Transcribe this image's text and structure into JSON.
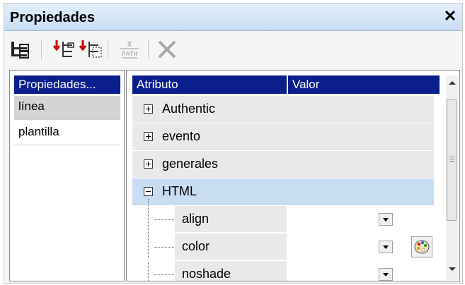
{
  "panel": {
    "title": "Propiedades",
    "close_glyph": "✕"
  },
  "toolbar": {
    "buttons": [
      {
        "name": "tree-layout-icon"
      },
      {
        "name": "add-child-icon"
      },
      {
        "name": "add-sibling-icon"
      },
      {
        "name": "xpath-icon",
        "line1": "X",
        "line2": "PATH"
      },
      {
        "name": "delete-icon"
      }
    ]
  },
  "left": {
    "header": "Propiedades...",
    "items": [
      {
        "label": "línea",
        "selected": true
      },
      {
        "label": "plantilla",
        "selected": false
      }
    ]
  },
  "right": {
    "columns": {
      "attribute": "Atributo",
      "value": "Valor"
    },
    "groups": [
      {
        "label": "Authentic",
        "expanded": false
      },
      {
        "label": "evento",
        "expanded": false
      },
      {
        "label": "generales",
        "expanded": false
      },
      {
        "label": "HTML",
        "expanded": true
      }
    ],
    "attributes": [
      {
        "label": "align",
        "value": ""
      },
      {
        "label": "color",
        "value": ""
      },
      {
        "label": "noshade",
        "value": ""
      }
    ]
  }
}
